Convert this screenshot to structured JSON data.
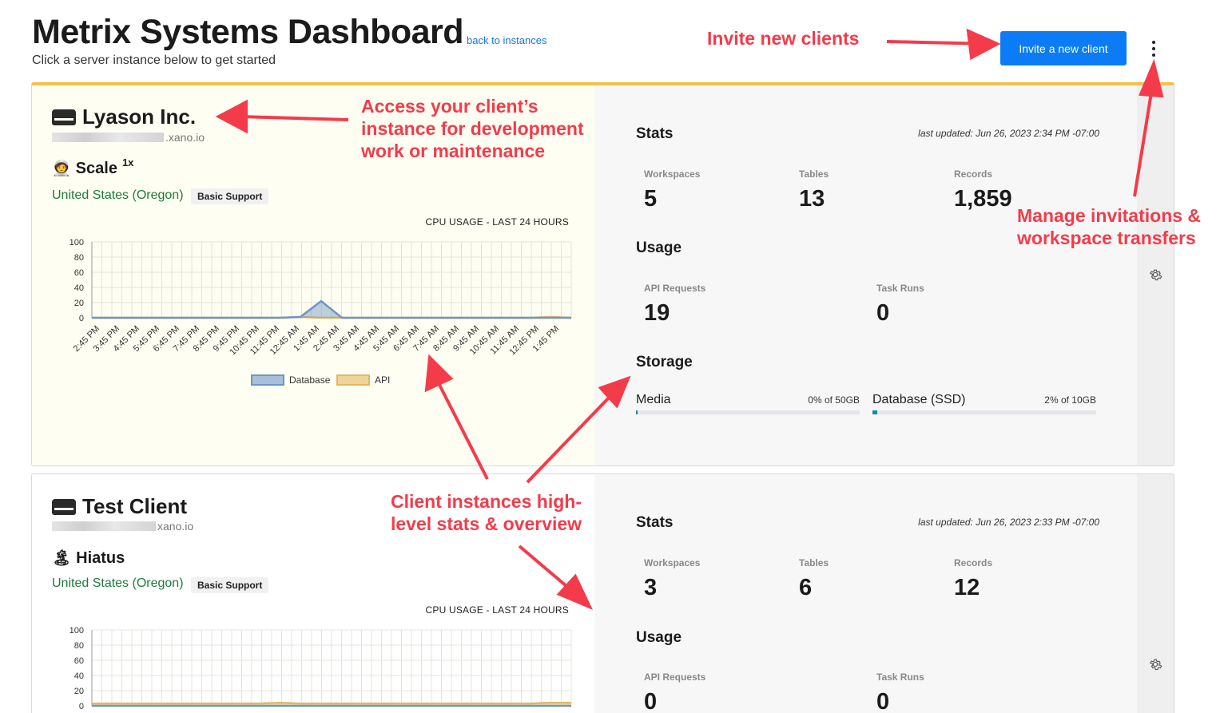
{
  "header": {
    "title": "Metrix Systems Dashboard",
    "back_link": "back to instances",
    "subtitle": "Click a server instance below to get started",
    "invite_button": "Invite a new client"
  },
  "instances": [
    {
      "name": "Lyason Inc.",
      "host_suffix": ".xano.io",
      "plan": "Scale",
      "plan_multiplier": "1x",
      "plan_icon": "astronaut-icon",
      "region": "United States (Oregon)",
      "support": "Basic Support",
      "chart_title": "CPU USAGE - LAST 24 HOURS",
      "stats_heading": "Stats",
      "last_updated": "last updated: Jun 26, 2023 2:34 PM -07:00",
      "workspaces_label": "Workspaces",
      "workspaces": "5",
      "tables_label": "Tables",
      "tables": "13",
      "records_label": "Records",
      "records": "1,859",
      "usage_heading": "Usage",
      "api_label": "API Requests",
      "api_requests": "19",
      "task_label": "Task Runs",
      "task_runs": "0",
      "storage_heading": "Storage",
      "media_label": "Media",
      "media_pct": "0% of 50GB",
      "media_fill": 0.005,
      "db_label": "Database (SSD)",
      "db_pct": "2% of 10GB",
      "db_fill": 0.02
    },
    {
      "name": "Test Client",
      "host_suffix": "xano.io",
      "plan": "Hiatus",
      "plan_icon": "island-icon",
      "region": "United States (Oregon)",
      "support": "Basic Support",
      "chart_title": "CPU USAGE - LAST 24 HOURS",
      "stats_heading": "Stats",
      "last_updated": "last updated: Jun 26, 2023 2:33 PM -07:00",
      "workspaces_label": "Workspaces",
      "workspaces": "3",
      "tables_label": "Tables",
      "tables": "6",
      "records_label": "Records",
      "records": "12",
      "usage_heading": "Usage",
      "api_label": "API Requests",
      "api_requests": "0",
      "task_label": "Task Runs",
      "task_runs": "0"
    }
  ],
  "chart_data": [
    {
      "type": "area",
      "title": "CPU USAGE - LAST 24 HOURS",
      "ylim": [
        0,
        100
      ],
      "yticks": [
        0,
        20,
        40,
        60,
        80,
        100
      ],
      "categories": [
        "2:45 PM",
        "3:45 PM",
        "4:45 PM",
        "5:45 PM",
        "6:45 PM",
        "7:45 PM",
        "8:45 PM",
        "9:45 PM",
        "10:45 PM",
        "11:45 PM",
        "12:45 AM",
        "1:45 AM",
        "2:45 AM",
        "3:45 AM",
        "4:45 AM",
        "5:45 AM",
        "6:45 AM",
        "7:45 AM",
        "8:45 AM",
        "9:45 AM",
        "10:45 AM",
        "11:45 AM",
        "12:45 PM",
        "1:45 PM"
      ],
      "series": [
        {
          "name": "Database",
          "color": "#6f95c4",
          "values": [
            0,
            0,
            0,
            0,
            0,
            0,
            0,
            0,
            0,
            0,
            1,
            22,
            0,
            0,
            0,
            0,
            0,
            0,
            0,
            0,
            0,
            0,
            0,
            0
          ]
        },
        {
          "name": "API",
          "color": "#e2b85f",
          "values": [
            0,
            0,
            0,
            0,
            0,
            0,
            0,
            0,
            0,
            0,
            1,
            0,
            0,
            0,
            0,
            0,
            0,
            0,
            0,
            0,
            0,
            0,
            1,
            0
          ]
        }
      ],
      "legend": "bottom"
    },
    {
      "type": "area",
      "title": "CPU USAGE - LAST 24 HOURS",
      "ylim": [
        0,
        100
      ],
      "yticks": [
        0,
        20,
        40,
        60,
        80,
        100
      ],
      "categories": [],
      "series": [
        {
          "name": "Database",
          "color": "#6f95c4",
          "values": [
            0,
            0,
            0,
            0,
            0,
            0,
            0,
            0,
            0,
            0,
            0,
            0,
            0,
            0,
            0,
            0,
            0,
            0,
            0,
            0,
            0,
            0,
            0,
            0
          ]
        },
        {
          "name": "API",
          "color": "#e2b85f",
          "values": [
            3,
            3,
            3,
            3,
            3,
            3,
            3,
            3,
            3,
            4,
            3,
            3,
            3,
            3,
            3,
            3,
            3,
            3,
            3,
            3,
            3,
            3,
            4,
            4
          ]
        }
      ]
    }
  ],
  "annotations": {
    "invite": "Invite new clients",
    "access_1": "Access your client’s",
    "access_2": "instance for development",
    "access_3": "work or maintenance",
    "manage_1": "Manage invitations &",
    "manage_2": "workspace transfers",
    "overview_1": "Client instances high-",
    "overview_2": "level stats & overview",
    "color": "#f43b4a"
  }
}
